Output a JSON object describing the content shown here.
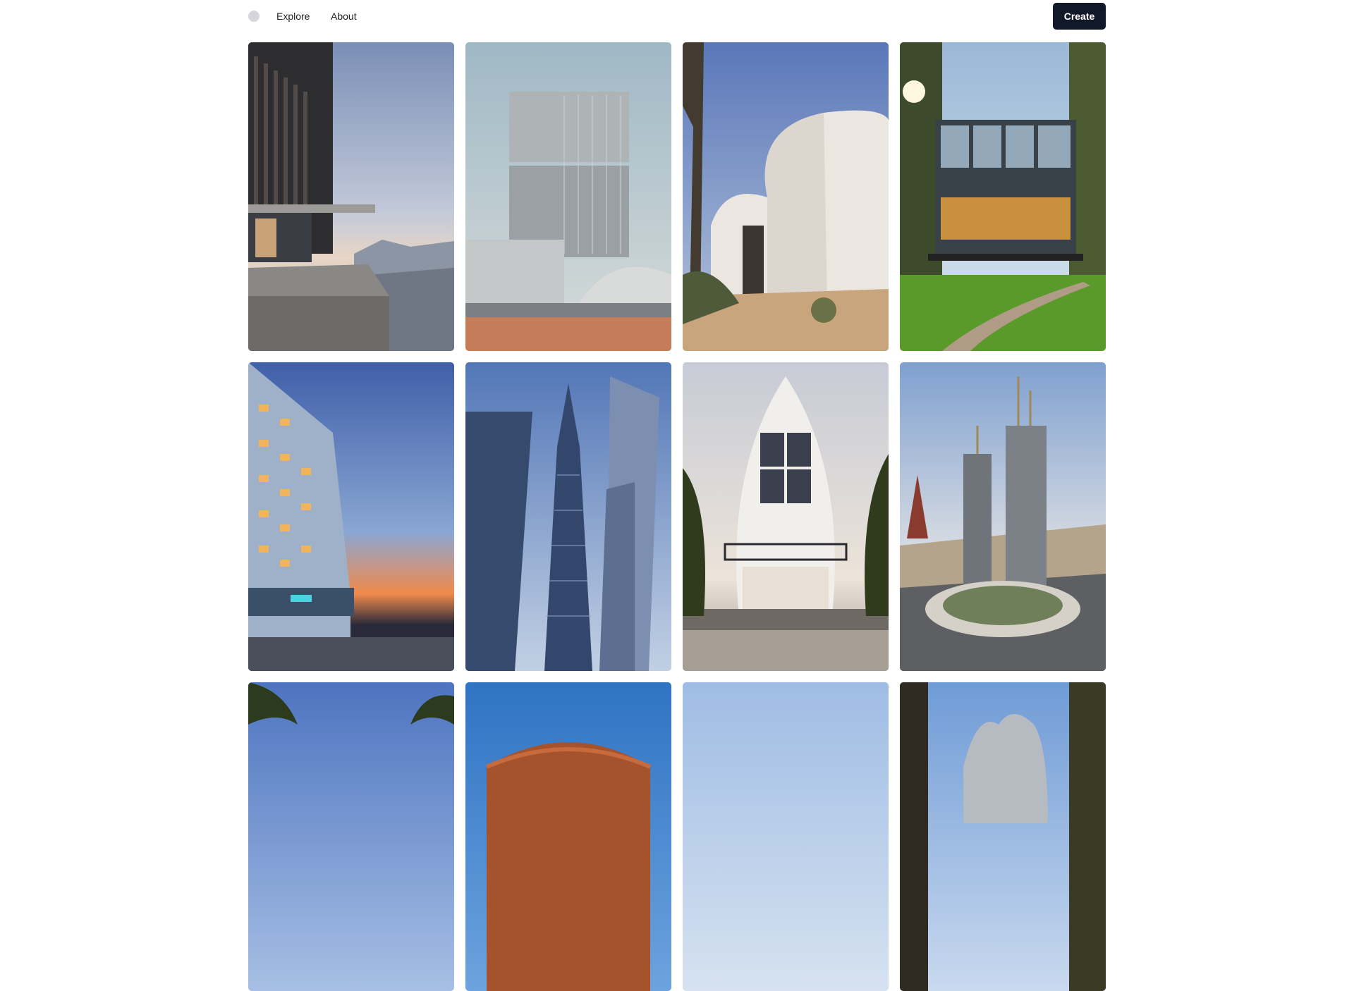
{
  "header": {
    "logo": "circle-logo-icon",
    "nav": [
      {
        "label": "Explore"
      },
      {
        "label": "About"
      }
    ],
    "create_label": "Create"
  },
  "colors": {
    "create_button_bg": "#111827",
    "logo_dot": "#d6d5dc"
  },
  "gallery": {
    "items": [
      {
        "subject": "cliffside-concrete-house-image"
      },
      {
        "subject": "white-tower-desert-image"
      },
      {
        "subject": "white-curved-desert-house-image"
      },
      {
        "subject": "glass-house-forest-image"
      },
      {
        "subject": "hotel-sunset-image"
      },
      {
        "subject": "glass-skyscrapers-image"
      },
      {
        "subject": "arched-beach-house-image"
      },
      {
        "subject": "twin-towers-city-image"
      },
      {
        "subject": "palm-trees-image"
      },
      {
        "subject": "red-dome-image"
      },
      {
        "subject": "pale-sky-image"
      },
      {
        "subject": "rock-pines-image"
      }
    ]
  }
}
